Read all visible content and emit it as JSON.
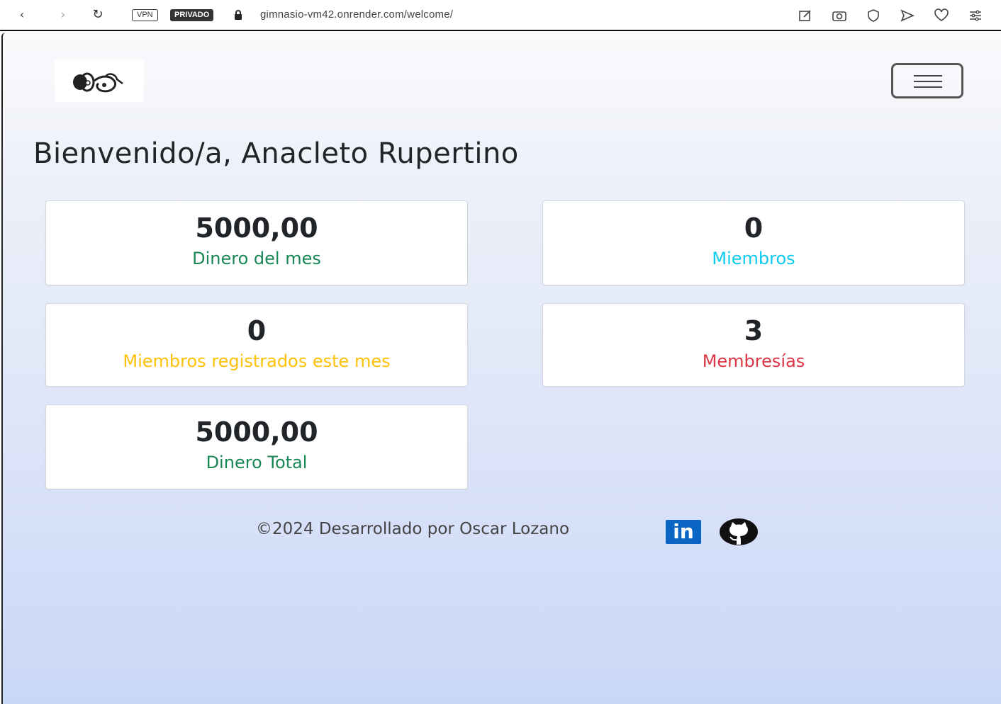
{
  "browser": {
    "back_icon": "‹",
    "forward_icon": "›",
    "reload_icon": "↻",
    "vpn_label": "VPN",
    "private_label": "PRIVADO",
    "url": "gimnasio-vm42.onrender.com/welcome/"
  },
  "header": {
    "logo": "gym-logo",
    "menu_toggle": "hamburger-icon"
  },
  "main": {
    "welcome": "Bienvenido/a, Anacleto Rupertino",
    "cards": [
      {
        "value": "5000,00",
        "label": "Dinero del mes",
        "color": "#198754"
      },
      {
        "value": "0",
        "label": "Miembros",
        "color": "#0dcaf0"
      },
      {
        "value": "0",
        "label": "Miembros registrados este mes",
        "color": "#ffc107"
      },
      {
        "value": "3",
        "label": "Membresías",
        "color": "#dc3545"
      },
      {
        "value": "5000,00",
        "label": "Dinero Total",
        "color": "#198754"
      }
    ]
  },
  "footer": {
    "text": "©2024 Desarrollado por Oscar Lozano",
    "linkedin_label": "in"
  }
}
